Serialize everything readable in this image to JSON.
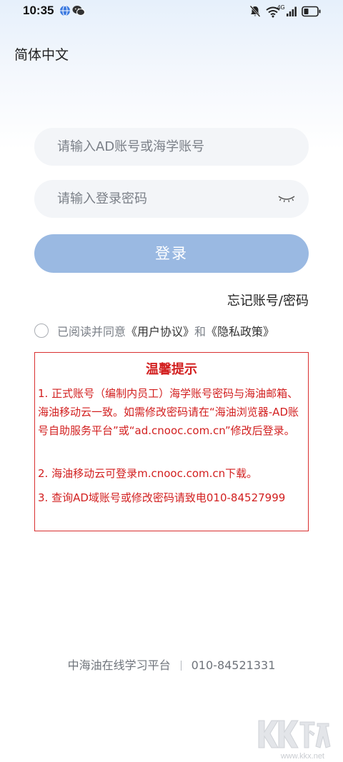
{
  "status_bar": {
    "time": "10:35",
    "network": "4G",
    "icons": [
      "browser-icon",
      "wechat-icon",
      "mute-icon",
      "wifi-icon",
      "signal-icon",
      "battery-icon"
    ]
  },
  "language": {
    "label": "简体中文"
  },
  "account_field": {
    "placeholder": "请输入AD账号或海学账号",
    "value": ""
  },
  "password_field": {
    "placeholder": "请输入登录密码",
    "value": "",
    "toggle_icon": "eye-closed-icon"
  },
  "login_button": {
    "label": "登录"
  },
  "forgot": {
    "label": "忘记账号/密码"
  },
  "agreement": {
    "prefix": "已阅读并同意",
    "user_agreement": "《用户协议》",
    "and": "和",
    "privacy_policy": "《隐私政策》",
    "checked": false
  },
  "notice": {
    "title": "温馨提示",
    "items": [
      "1. 正式账号（编制内员工）海学账号密码与海油邮箱、海油移动云一致。如需修改密码请在“海油浏览器-AD账号自助服务平台”或“ad.cnooc.com.cn”修改后登录。",
      "2. 海油移动云可登录m.cnooc.com.cn下载。",
      "3. 查询AD域账号或修改密码请致电010-84527999"
    ]
  },
  "footer": {
    "platform": "中海油在线学习平台",
    "phone": "010-84521331"
  },
  "watermark": {
    "logo_text": "KK下载",
    "url": "www.kkx.net"
  },
  "colors": {
    "accent_button": "#9ab9e2",
    "notice_red": "#d21f1f",
    "field_bg": "#f3f5f8"
  }
}
